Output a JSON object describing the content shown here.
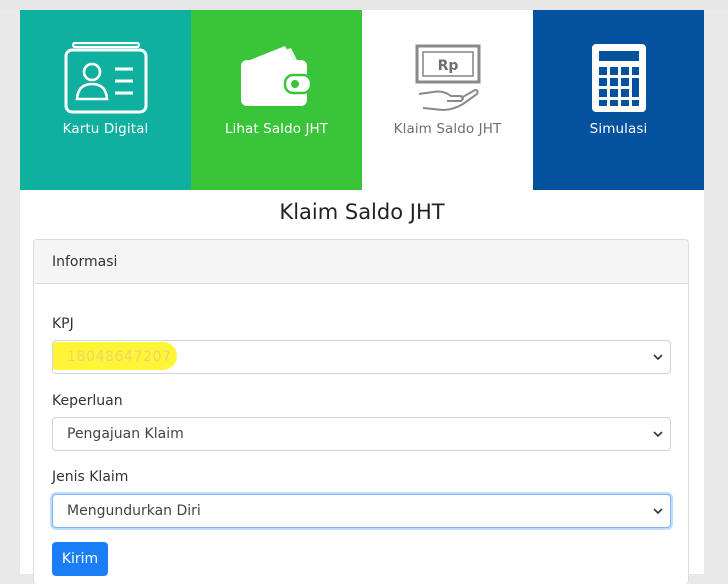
{
  "tiles": [
    {
      "label": "Kartu Digital",
      "icon": "id-card-icon",
      "color": "#0fb0a0"
    },
    {
      "label": "Lihat Saldo JHT",
      "icon": "wallet-icon",
      "color": "#39c43a"
    },
    {
      "label": "Klaim Saldo JHT",
      "icon": "money-hand-icon",
      "color": "#ffffff"
    },
    {
      "label": "Simulasi",
      "icon": "calculator-icon",
      "color": "#04519e"
    }
  ],
  "money_icon_text": "Rp",
  "page_title": "Klaim Saldo JHT",
  "panel": {
    "header": "Informasi",
    "kpj": {
      "label": "KPJ",
      "value": "18048647207"
    },
    "keperluan": {
      "label": "Keperluan",
      "value": "Pengajuan Klaim"
    },
    "jenis_klaim": {
      "label": "Jenis Klaim",
      "value": "Mengundurkan Diri"
    },
    "submit_label": "Kirim"
  },
  "colors": {
    "accent": "#1a7ff6",
    "highlight": "#fff32a"
  }
}
